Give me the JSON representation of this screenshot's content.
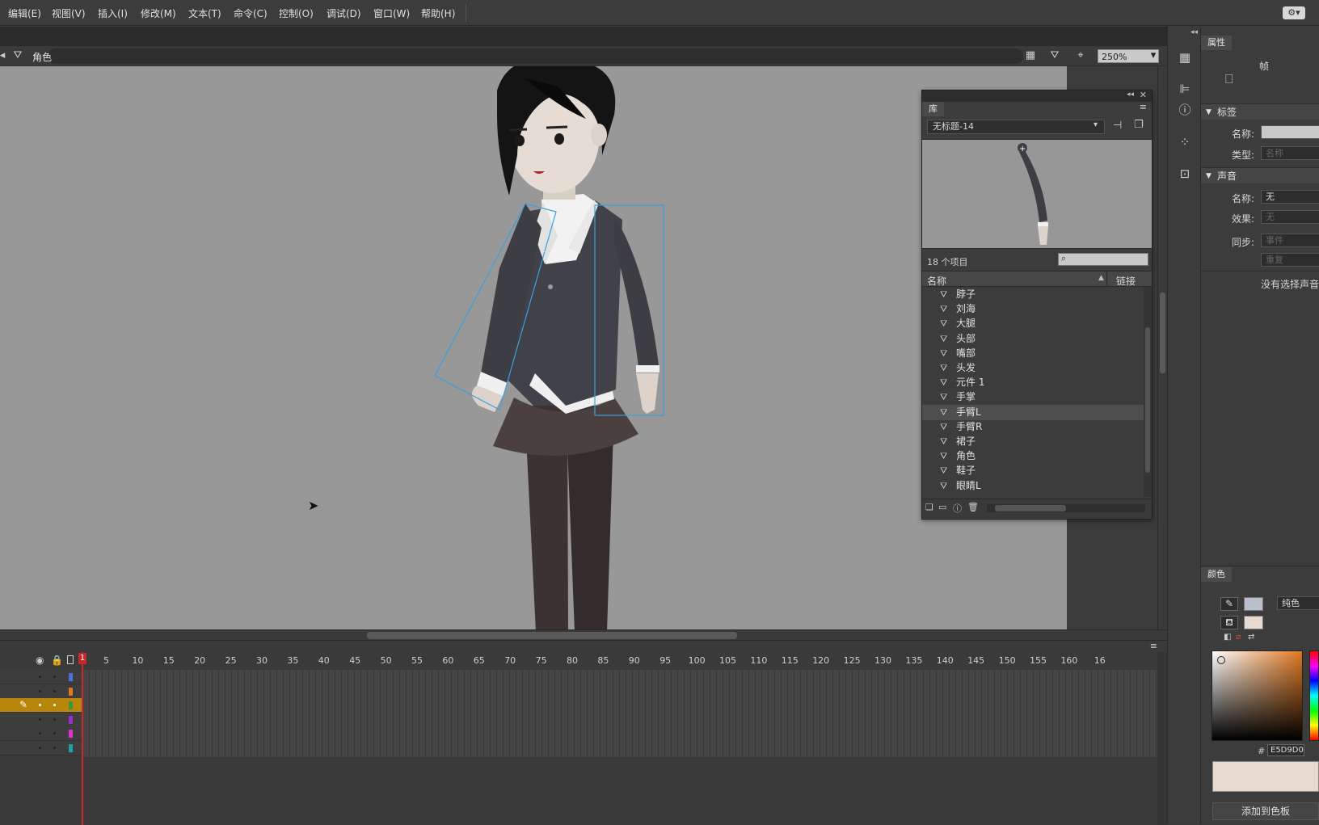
{
  "menu": [
    "编辑(E)",
    "视图(V)",
    "插入(I)",
    "修改(M)",
    "文本(T)",
    "命令(C)",
    "控制(O)",
    "调试(D)",
    "窗口(W)",
    "帮助(H)"
  ],
  "editbar": {
    "scene": "角色",
    "zoom": "250%"
  },
  "properties": {
    "tab": "属性",
    "frame_label": "帧",
    "label_section": "标签",
    "label_name": "名称:",
    "label_type": "类型:",
    "label_type_value": "名称",
    "sound_section": "声音",
    "sound_name": "名称:",
    "sound_name_value": "无",
    "sound_effect": "效果:",
    "sound_effect_value": "无",
    "sound_sync": "同步:",
    "sound_sync_value": "事件",
    "sound_repeat_value": "重复",
    "no_sound": "没有选择声音"
  },
  "color": {
    "tab": "颜色",
    "fill_type": "纯色",
    "hex_prefix": "#",
    "hex": "E5D9D0",
    "stroke_color": "#b9c0cc",
    "fill_color": "#e5d9d0",
    "add_swatch": "添加到色板"
  },
  "library": {
    "tab": "库",
    "document": "无标题-14",
    "count": "18 个项目",
    "col_name": "名称",
    "col_link": "链接",
    "items": [
      "脖子",
      "刘海",
      "大腿",
      "头部",
      "嘴部",
      "头发",
      "元件 1",
      "手掌",
      "手臂L",
      "手臂R",
      "裙子",
      "角色",
      "鞋子",
      "眼睛L"
    ],
    "selected_index": 8
  },
  "timeline": {
    "ruler": [
      "1",
      "5",
      "10",
      "15",
      "20",
      "25",
      "30",
      "35",
      "40",
      "45",
      "50",
      "55",
      "60",
      "65",
      "70",
      "75",
      "80",
      "85",
      "90",
      "95",
      "100",
      "105",
      "110",
      "115",
      "120",
      "125",
      "130",
      "135",
      "140",
      "145",
      "150",
      "155",
      "160",
      "16"
    ],
    "layer_colors": [
      "#4a6fe0",
      "#e07820",
      "#3a9a3a",
      "#9a30c8",
      "#e030d0",
      "#20a0a0"
    ],
    "active_layer": 2
  }
}
